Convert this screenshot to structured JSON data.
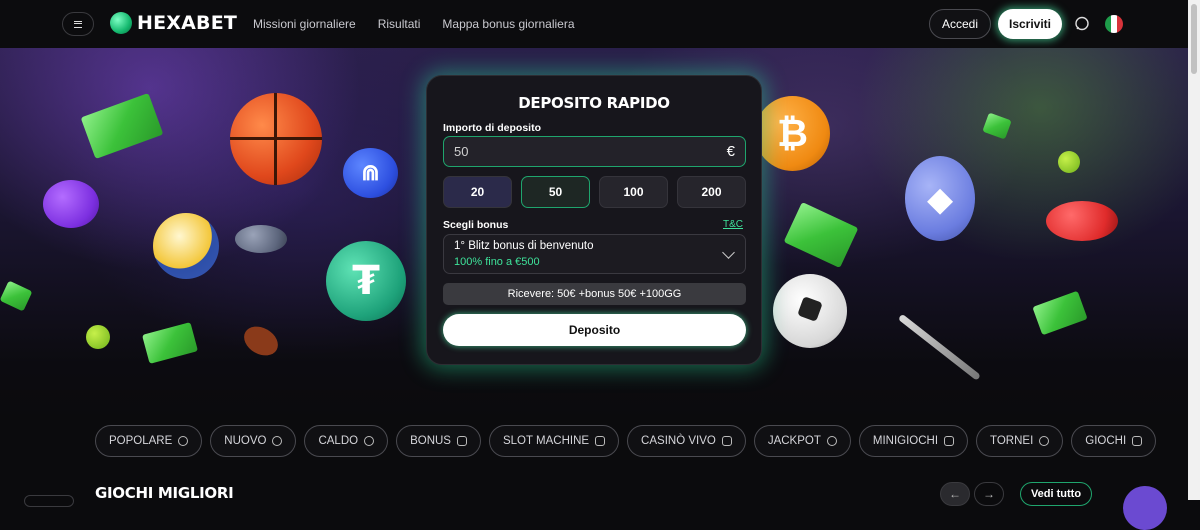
{
  "header": {
    "brand": "HEXABET",
    "nav": [
      "Missioni giornaliere",
      "Risultati",
      "Mappa bonus giornaliera"
    ],
    "login_label": "Accedi",
    "register_label": "Iscriviti"
  },
  "deposit": {
    "title": "DEPOSITO RAPIDO",
    "amount_label": "Importo di deposito",
    "amount_value": "50",
    "currency_symbol": "€",
    "preset_amounts": [
      "20",
      "50",
      "100",
      "200"
    ],
    "selected_amount": "50",
    "bonus_label": "Scegli bonus",
    "tc_link": "T&C",
    "bonus_title": "1° Blitz bonus di benvenuto",
    "bonus_subtitle": "100% fino a €500",
    "receive_text": "Ricevere: 50€ +bonus 50€ +100GG",
    "deposit_button": "Deposito"
  },
  "categories": [
    "POPOLARE",
    "NUOVO",
    "CALDO",
    "BONUS",
    "SLOT MACHINE",
    "CASINÒ VIVO",
    "JACKPOT",
    "MINIGIOCHI",
    "TORNEI",
    "GIOCHI"
  ],
  "games": {
    "title": "GIOCHI MIGLIORI",
    "see_all": "Vedi tutto"
  },
  "colors": {
    "accent_green": "#1fa56d",
    "text_green": "#3ee29a",
    "background": "#0b0b0d"
  },
  "icons": {
    "menu": "hamburger-icon",
    "chat": "search-chat-icon",
    "flag": "italy-flag-icon"
  }
}
